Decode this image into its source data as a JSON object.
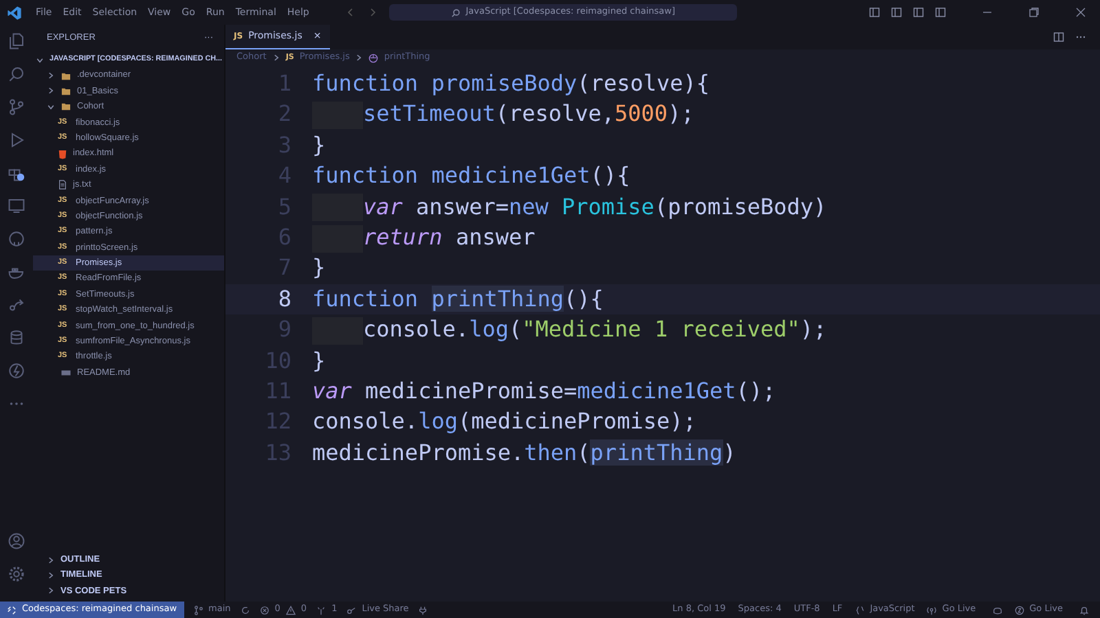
{
  "menu": [
    "File",
    "Edit",
    "Selection",
    "View",
    "Go",
    "Run",
    "Terminal",
    "Help"
  ],
  "command_center": "JavaScript [Codespaces: reimagined chainsaw]",
  "sidebar": {
    "title": "EXPLORER",
    "more": "···",
    "root": "JAVASCRIPT [CODESPACES: REIMAGINED CH...",
    "expanded": true,
    "items": [
      {
        "kind": "folder",
        "label": ".devcontainer",
        "expanded": false,
        "selected": false
      },
      {
        "kind": "folder",
        "label": "01_Basics",
        "expanded": false,
        "selected": false
      },
      {
        "kind": "folder",
        "label": "Cohort",
        "expanded": true,
        "selected": false,
        "children": [
          {
            "kind": "js",
            "badge": "JS",
            "label": "fibonacci.js",
            "selected": false
          },
          {
            "kind": "js",
            "badge": "JS",
            "label": "hollowSquare.js",
            "selected": false
          },
          {
            "kind": "html",
            "label": "index.html",
            "selected": false
          },
          {
            "kind": "js",
            "badge": "JS",
            "label": "index.js",
            "selected": false
          },
          {
            "kind": "txt",
            "label": "js.txt",
            "selected": false
          },
          {
            "kind": "js",
            "badge": "JS",
            "label": "objectFuncArray.js",
            "selected": false
          },
          {
            "kind": "js",
            "badge": "JS",
            "label": "objectFunction.js",
            "selected": false
          },
          {
            "kind": "js",
            "badge": "JS",
            "label": "pattern.js",
            "selected": false
          },
          {
            "kind": "js",
            "badge": "JS",
            "label": "printtoScreen.js",
            "selected": false
          },
          {
            "kind": "js",
            "badge": "JS",
            "label": "Promises.js",
            "selected": true
          },
          {
            "kind": "js",
            "badge": "JS",
            "label": "ReadFromFile.js",
            "selected": false
          },
          {
            "kind": "js",
            "badge": "JS",
            "label": "SetTimeouts.js",
            "selected": false
          },
          {
            "kind": "js",
            "badge": "JS",
            "label": "stopWatch_setInterval.js",
            "selected": false
          },
          {
            "kind": "js",
            "badge": "JS",
            "label": "sum_from_one_to_hundred.js",
            "selected": false
          },
          {
            "kind": "js",
            "badge": "JS",
            "label": "sumfromFile_Asynchronus.js",
            "selected": false
          },
          {
            "kind": "js",
            "badge": "JS",
            "label": "throttle.js",
            "selected": false
          }
        ]
      },
      {
        "kind": "md",
        "label": "README.md",
        "selected": false
      }
    ],
    "sections": [
      "OUTLINE",
      "TIMELINE",
      "VS CODE PETS"
    ]
  },
  "tabs": [
    {
      "badge": "JS",
      "label": "Promises.js",
      "close": "×",
      "selected": true
    }
  ],
  "breadcrumbs": [
    "Cohort",
    "JS",
    "Promises.js",
    "printThing"
  ],
  "code": [
    {
      "number": "1",
      "current": false,
      "indented": false,
      "tokens": [
        {
          "kind": "kw",
          "t": "function "
        },
        {
          "kind": "fn",
          "t": "promiseBody"
        },
        {
          "kind": "p",
          "t": "(resolve){"
        }
      ]
    },
    {
      "number": "2",
      "current": false,
      "indented": true,
      "tokens": [
        {
          "kind": "fn",
          "t": "setTimeout"
        },
        {
          "kind": "p",
          "t": "(resolve,"
        },
        {
          "kind": "num",
          "t": "5000"
        },
        {
          "kind": "p",
          "t": ");"
        }
      ]
    },
    {
      "number": "3",
      "current": false,
      "indented": false,
      "tokens": [
        {
          "kind": "p",
          "t": "}"
        }
      ]
    },
    {
      "number": "4",
      "current": false,
      "indented": false,
      "tokens": [
        {
          "kind": "kw",
          "t": "function "
        },
        {
          "kind": "fn",
          "t": "medicine1Get"
        },
        {
          "kind": "p",
          "t": "(){"
        }
      ]
    },
    {
      "number": "5",
      "current": false,
      "indented": true,
      "tokens": [
        {
          "kind": "var",
          "t": "var "
        },
        {
          "kind": "p",
          "t": "answer="
        },
        {
          "kind": "kw",
          "t": "new "
        },
        {
          "kind": "cls",
          "t": "Promise"
        },
        {
          "kind": "p",
          "t": "(promiseBody)"
        }
      ]
    },
    {
      "number": "6",
      "current": false,
      "indented": true,
      "tokens": [
        {
          "kind": "var",
          "t": "return "
        },
        {
          "kind": "p",
          "t": "answer"
        }
      ]
    },
    {
      "number": "7",
      "current": false,
      "indented": false,
      "tokens": [
        {
          "kind": "p",
          "t": "}"
        }
      ]
    },
    {
      "number": "8",
      "current": true,
      "indented": false,
      "tokens": [
        {
          "kind": "kw",
          "t": "function "
        },
        {
          "kind": "hl",
          "t": "printThing"
        },
        {
          "kind": "p",
          "t": "(){"
        }
      ]
    },
    {
      "number": "9",
      "current": false,
      "indented": true,
      "tokens": [
        {
          "kind": "p",
          "t": "console."
        },
        {
          "kind": "fn",
          "t": "log"
        },
        {
          "kind": "p",
          "t": "("
        },
        {
          "kind": "str",
          "t": "\"Medicine 1 received\""
        },
        {
          "kind": "p",
          "t": ");"
        }
      ]
    },
    {
      "number": "10",
      "current": false,
      "indented": false,
      "tokens": [
        {
          "kind": "p",
          "t": "}"
        }
      ]
    },
    {
      "number": "11",
      "current": false,
      "indented": false,
      "tokens": [
        {
          "kind": "var",
          "t": "var "
        },
        {
          "kind": "p",
          "t": "medicinePromise="
        },
        {
          "kind": "fn",
          "t": "medicine1Get"
        },
        {
          "kind": "p",
          "t": "();"
        }
      ]
    },
    {
      "number": "12",
      "current": false,
      "indented": false,
      "tokens": [
        {
          "kind": "p",
          "t": "console."
        },
        {
          "kind": "fn",
          "t": "log"
        },
        {
          "kind": "p",
          "t": "(medicinePromise);"
        }
      ]
    },
    {
      "number": "13",
      "current": false,
      "indented": false,
      "tokens": [
        {
          "kind": "p",
          "t": "medicinePromise."
        },
        {
          "kind": "fn",
          "t": "then"
        },
        {
          "kind": "p",
          "t": "("
        },
        {
          "kind": "hl",
          "t": "printThing"
        },
        {
          "kind": "p",
          "t": ")"
        }
      ]
    }
  ],
  "status_bar": {
    "remote": "Codespaces: reimagined chainsaw",
    "branch": "main",
    "errors": "0",
    "warnings": "0",
    "ports": "1",
    "live_share": "Live Share",
    "right": [
      "Ln 8, Col 19",
      "Spaces: 4",
      "UTF-8",
      "LF",
      "JavaScript",
      "Go Live",
      "Go Live"
    ]
  }
}
